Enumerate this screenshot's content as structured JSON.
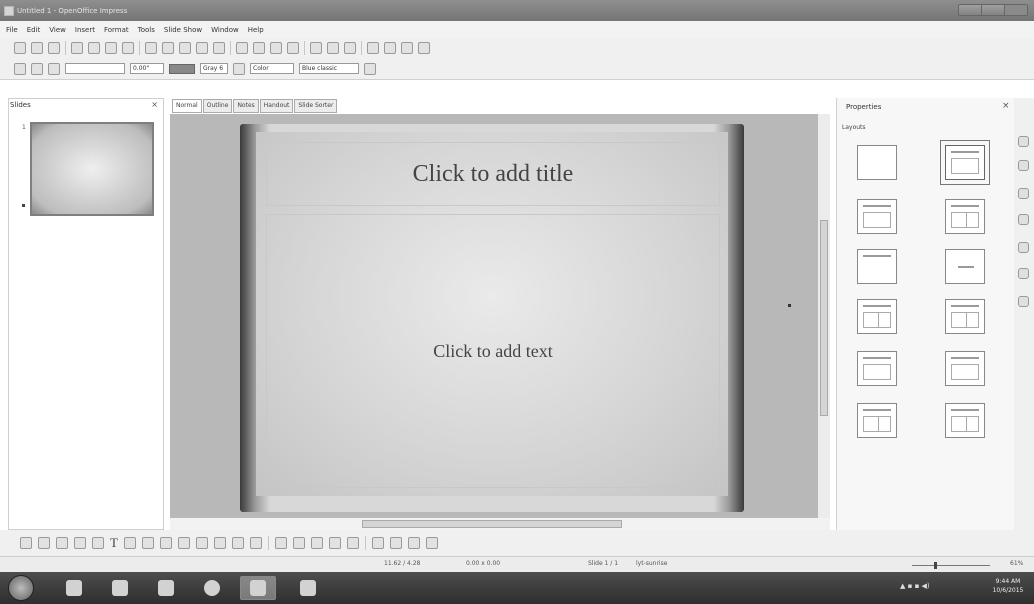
{
  "window": {
    "title": "Untitled 1 - OpenOffice Impress"
  },
  "menu": [
    "File",
    "Edit",
    "View",
    "Insert",
    "Format",
    "Tools",
    "Slide Show",
    "Window",
    "Help"
  ],
  "format_bar": {
    "line_width": "0.00\"",
    "area_color": "Gray 6",
    "fill_mode": "Color",
    "fill_color": "Blue classic"
  },
  "slides_pane": {
    "title": "Slides",
    "thumbnail_number": "1"
  },
  "view_tabs": [
    "Normal",
    "Outline",
    "Notes",
    "Handout",
    "Slide Sorter"
  ],
  "slide": {
    "title_placeholder": "Click to add title",
    "content_placeholder": "Click to add text"
  },
  "properties": {
    "title": "Properties",
    "section": "Layouts"
  },
  "draw_toolbar": {
    "text_tool": "T"
  },
  "status": {
    "position": "11.62 / 4.28",
    "size": "0.00 x 0.00",
    "slide": "Slide 1 / 1",
    "theme": "lyt-sunrise",
    "zoom": "61%"
  },
  "taskbar": {
    "time": "9:44 AM",
    "date": "10/6/2015"
  }
}
